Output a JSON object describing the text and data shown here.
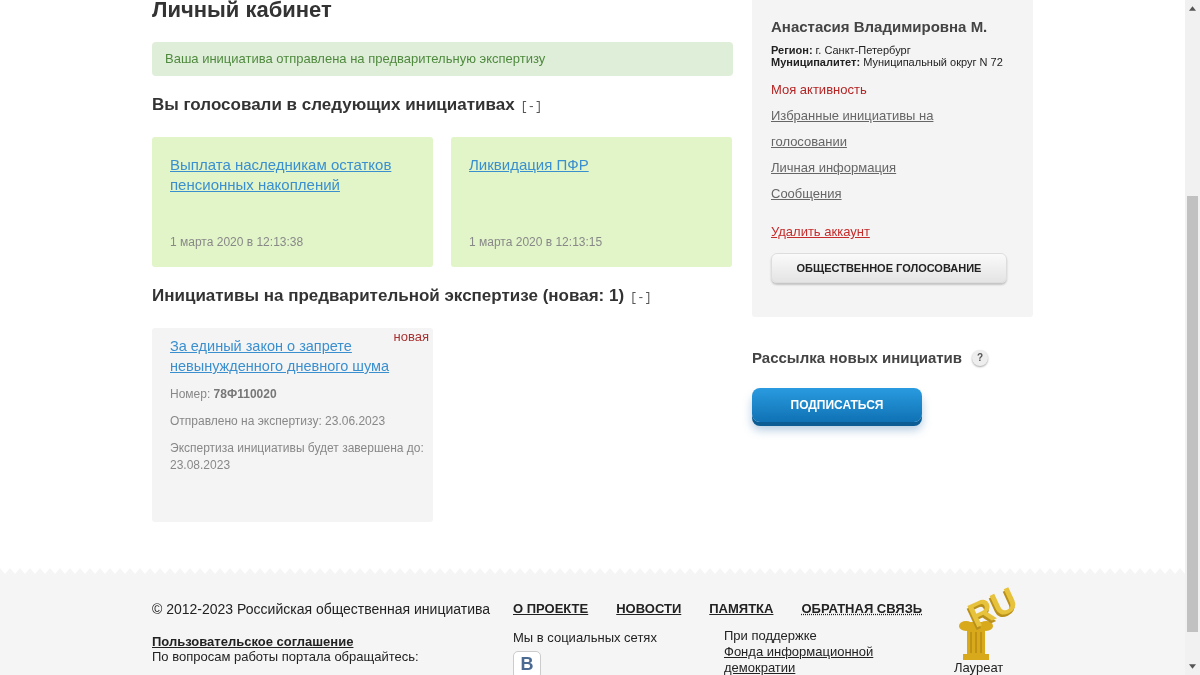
{
  "page_title": "Личный кабинет",
  "notice": "Ваша инициатива отправлена на предварительную экспертизу",
  "voted_section": {
    "title": "Вы голосовали в следующих инициативах",
    "toggle": "[-]",
    "items": [
      {
        "title": "Выплата наследникам остатков пенсионных накоплений",
        "date": "1 марта 2020 в 12:13:38"
      },
      {
        "title": "Ликвидация ПФР",
        "date": "1 марта 2020 в 12:13:15"
      }
    ]
  },
  "review_section": {
    "title": "Инициативы на предварительной экспертизе (новая: 1)",
    "toggle": "[-]",
    "items": [
      {
        "title": "За единый закон о запрете невынужденного дневного шума",
        "badge": "новая",
        "number": "Номер: **78Ф110020**",
        "sent": "Отправлено на экспертизу: 23.06.2023",
        "deadline": "Экспертиза инициативы будет завершена до: 23.08.2023"
      }
    ]
  },
  "profile": {
    "name": "Анастасия Владимировна М.",
    "fields": [
      "**Регион:** г. Санкт-Петербург",
      "**Муниципалитет:** Муниципальный округ N 72"
    ],
    "links": [
      {
        "label": "Моя активность",
        "selected": true
      },
      {
        "label": "Избранные инициативы на голосовании",
        "selected": false
      },
      {
        "label": "Личная информация",
        "selected": false
      },
      {
        "label": "Сообщения",
        "selected": false
      }
    ],
    "delete_link": "Удалить аккаунт",
    "button": "ОБЩЕСТВЕННОЕ ГОЛОСОВАНИЕ"
  },
  "newsletter": {
    "title": "Рассылка новых инициатив",
    "help": "?",
    "button": "ПОДПИСАТЬСЯ"
  },
  "footer": {
    "copyright": "© 2012-2023 Российская общественная инициатива",
    "agreement": "Пользовательское соглашение",
    "contact": "По вопросам работы портала обращайтесь:",
    "nav": [
      {
        "label": "О ПРОЕКТЕ",
        "kind": "solid"
      },
      {
        "label": "НОВОСТИ",
        "kind": "solid"
      },
      {
        "label": "ПАМЯТКА",
        "kind": "solid"
      },
      {
        "label": "ОБРАТНАЯ СВЯЗЬ",
        "kind": "dotted"
      }
    ],
    "social_title": "Мы в социальных сетях",
    "social_icon": "В",
    "support_text": "При поддержке",
    "support_link": "Фонда информационной демократии",
    "logo_text": "RU",
    "logo_caption": "Лауреат"
  }
}
